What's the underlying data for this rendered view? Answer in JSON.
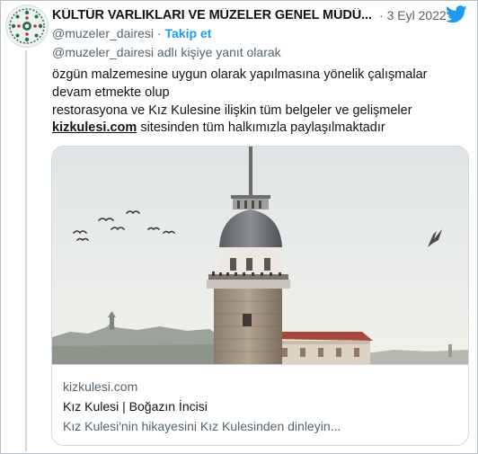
{
  "tweet": {
    "author_name": "KÜLTÜR VARLIKLARI VE MÜZELER GENEL MÜDÜ...",
    "date_separator": "·",
    "date": "3 Eyl 2022",
    "handle": "@muzeler_dairesi",
    "follow_separator": "·",
    "follow_label": "Takip et",
    "reply_prefix": "@muzeler_dairesi adlı kişiye yanıt olarak",
    "text_lines": [
      "özgün malzemesine uygun olarak yapılmasına yönelik çalışmalar",
      "devam etmekte olup",
      "restorasyona ve Kız Kulesine ilişkin tüm belgeler ve gelişmeler"
    ],
    "link_text": "kizkulesi.com",
    "text_after_link": " sitesinden tüm halkımızla paylaşılmaktadır"
  },
  "card": {
    "domain": "kizkulesi.com",
    "title": "Kız Kulesi | Boğazın İncisi",
    "description": "Kız Kulesi'nin hikayesini Kız Kulesinden dinleyin..."
  },
  "icons": {
    "platform": "twitter-bird-icon",
    "avatar": "museum-seal-logo"
  },
  "colors": {
    "accent": "#1d9bf0",
    "text": "#0f1419",
    "muted": "#536471",
    "border": "#cfd9de"
  }
}
